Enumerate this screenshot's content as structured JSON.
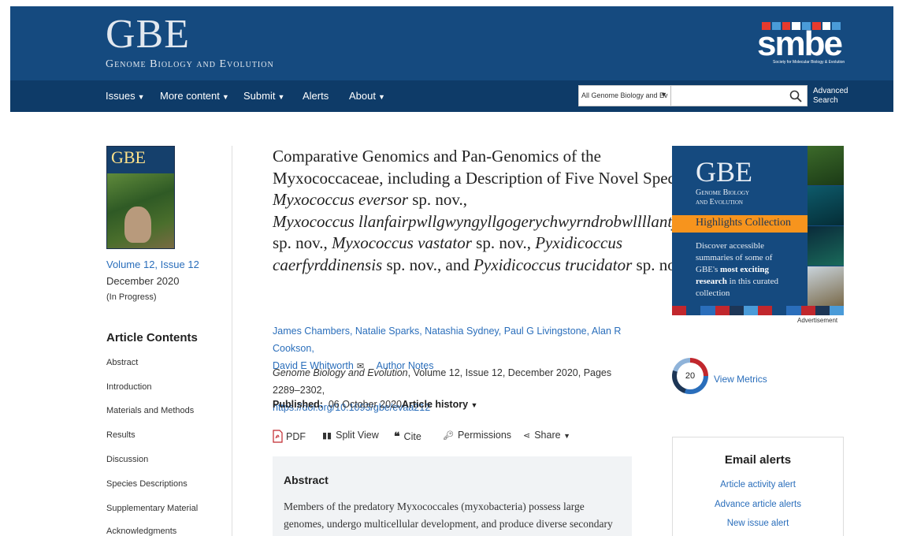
{
  "header": {
    "logo_big": "GBE",
    "logo_sub": "Genome Biology and Evolution",
    "smbe_word": "smbe",
    "smbe_tag": "Society for Molecular Biology & Evolution",
    "smbe_bar_colors": [
      "#e63a2e",
      "#4a9bd8",
      "#e63a2e",
      "#ffffff",
      "#4a9bd8",
      "#e63a2e",
      "#ffffff",
      "#4a9bd8"
    ]
  },
  "nav": {
    "items": [
      "Issues",
      "More content",
      "Submit",
      "Alerts",
      "About"
    ],
    "search_scope": "All Genome Biology and Ev",
    "search_placeholder": "",
    "advanced_search": [
      "Advanced",
      "Search"
    ]
  },
  "issue": {
    "cover_title": "GBE",
    "volume_link": "Volume 12, Issue 12",
    "date": "December 2020",
    "status": "(In Progress)"
  },
  "contents": {
    "title": "Article Contents",
    "items": [
      "Abstract",
      "Introduction",
      "Materials and Methods",
      "Results",
      "Discussion",
      "Species Descriptions",
      "Supplementary Material",
      "Acknowledgments"
    ]
  },
  "article": {
    "title_parts": [
      {
        "text": "Comparative Genomics and Pan-Genomics of the Myxococcaceae, including a Description of Five Novel Species: ",
        "italic": false
      },
      {
        "text": "Myxococcus eversor",
        "italic": true
      },
      {
        "text": " sp. nov., ",
        "italic": false
      },
      {
        "text": "Myxococcus llanfairpwllgwyngyllgogerychwyrndrobwllllantysiliogogogochensis",
        "italic": true
      },
      {
        "text": " sp. nov., ",
        "italic": false
      },
      {
        "text": "Myxococcus vastator",
        "italic": true
      },
      {
        "text": " sp. nov., ",
        "italic": false
      },
      {
        "text": "Pyxidicoccus caerfyrddinensis",
        "italic": true
      },
      {
        "text": " sp. nov., and ",
        "italic": false
      },
      {
        "text": "Pyxidicoccus trucidator",
        "italic": true
      },
      {
        "text": " sp. nov.",
        "italic": false
      }
    ],
    "authors": [
      "James Chambers",
      "Natalie Sparks",
      "Natashia Sydney",
      "Paul G Livingstone",
      "Alan R Cookson",
      "David E Whitworth"
    ],
    "author_notes": "Author Notes",
    "journal": "Genome Biology and Evolution",
    "citation_rest": ", Volume 12, Issue 12, December 2020, Pages 2289–2302,",
    "doi": "https://doi.org/10.1093/gbe/evaa212",
    "published_label": "Published:",
    "published_date": "06 October 2020",
    "history": "Article history"
  },
  "toolbar": {
    "pdf": "PDF",
    "split_view": "Split View",
    "cite": "Cite",
    "permissions": "Permissions",
    "share": "Share"
  },
  "abstract": {
    "title": "Abstract",
    "text": "Members of the predatory Myxococcales (myxobacteria) possess large genomes, undergo multicellular development, and produce diverse secondary"
  },
  "ad": {
    "gbe": "GBE",
    "sub_1": "Genome Biology",
    "sub_2": "and Evolution",
    "orange": "Highlights Collection",
    "body_plain_1": "Discover accessible summaries of some of GBE's ",
    "body_bold_1": "most exciting research",
    "body_plain_2": " in this curated collection",
    "label": "Advertisement",
    "strip_colors": [
      "#c1272d",
      "#154a7f",
      "#2a6ebb",
      "#c1272d",
      "#1d3656",
      "#4a9bd8",
      "#c1272d",
      "#154a7f",
      "#2a6ebb",
      "#c1272d",
      "#1d3656",
      "#4a9bd8"
    ]
  },
  "metrics": {
    "count": "20",
    "label": "View Metrics"
  },
  "email_alerts": {
    "title": "Email alerts",
    "links": [
      "Article activity alert",
      "Advance article alerts",
      "New issue alert"
    ]
  }
}
